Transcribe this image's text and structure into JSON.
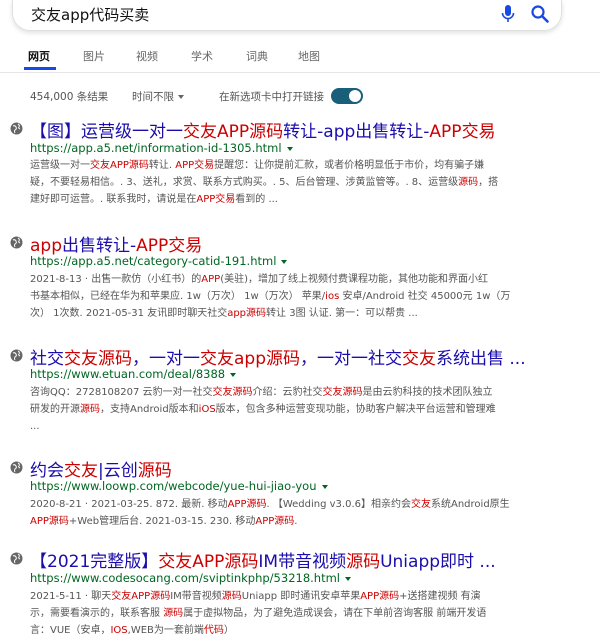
{
  "search": {
    "query": "交友app代码买卖"
  },
  "tabs": [
    "网页",
    "图片",
    "视频",
    "学术",
    "词典",
    "地图"
  ],
  "toolbar": {
    "count": "454,000 条结果",
    "time": "时间不限",
    "new_tab": "在新选项卡中打开链接"
  },
  "colors": {
    "link": "#1a0dab",
    "highlight": "#cc0000",
    "url": "#006621",
    "accent": "#174ae4",
    "toggle": "#1a5f7a"
  },
  "results": [
    {
      "title": [
        [
          "【图】运营级一对一",
          false
        ],
        [
          "交友",
          true
        ],
        [
          "APP",
          true
        ],
        [
          "源码",
          true
        ],
        [
          "转让-app出售转让-",
          false
        ],
        [
          "APP",
          true
        ],
        [
          "交易",
          true
        ]
      ],
      "url": "https://app.a5.net/information-id-1305.html",
      "lines": [
        [
          [
            "运营级一对一",
            false
          ],
          [
            "交友",
            true
          ],
          [
            "APP",
            true
          ],
          [
            "源码",
            true
          ],
          [
            "转让. ",
            false
          ],
          [
            "APP",
            true
          ],
          [
            "交易",
            true
          ],
          [
            "提醒您：让你提前汇款，或者价格明显低于市价，均有骗子嫌",
            false
          ]
        ],
        [
          [
            "疑，不要轻易相信。. 3、送礼，求赏、联系方式购买。. 5、后台管理、涉黄监管等。. 8、运营级",
            false
          ],
          [
            "源码",
            true
          ],
          [
            "，搭",
            false
          ]
        ],
        [
          [
            "建好即可运营。. 联系我时，请说是在",
            false
          ],
          [
            "APP",
            true
          ],
          [
            "交易",
            true
          ],
          [
            "看到的 ...",
            false
          ]
        ]
      ]
    },
    {
      "title": [
        [
          "app",
          true
        ],
        [
          "出售转让-",
          false
        ],
        [
          "APP",
          true
        ],
        [
          "交易",
          true
        ]
      ],
      "url": "https://app.a5.net/category-catid-191.html",
      "lines": [
        [
          [
            "2021-8-13 · 出售一款仿（小红书）的",
            false
          ],
          [
            "APP",
            true
          ],
          [
            "(美驻)，增加了线上视频付费课程功能，其他功能和界面小红",
            false
          ]
        ],
        [
          [
            "书基本相似，已经在华为和苹果应. 1w（万次） 1w（万次） 苹果/",
            false
          ],
          [
            "ios",
            true
          ],
          [
            " 安卓/Android 社交 45000元 1w（万",
            false
          ]
        ],
        [
          [
            "次） 1次数. 2021-05-31 友讯即时聊天社交",
            false
          ],
          [
            "app",
            true
          ],
          [
            "源码",
            true
          ],
          [
            "转让 3图 认证. 第一：可以帮贵 ...",
            false
          ]
        ]
      ]
    },
    {
      "title": [
        [
          "社交",
          false
        ],
        [
          "交友",
          true
        ],
        [
          "源码",
          true
        ],
        [
          "，一对一",
          false
        ],
        [
          "交友",
          true
        ],
        [
          "app",
          true
        ],
        [
          "源码",
          true
        ],
        [
          "，一对一社交",
          false
        ],
        [
          "交友",
          true
        ],
        [
          "系统出售 ...",
          false
        ]
      ],
      "url": "https://www.etuan.com/deal/8388",
      "lines": [
        [
          [
            "咨询QQ：2728108207 云豹一对一社交",
            false
          ],
          [
            "交友",
            true
          ],
          [
            "源码",
            true
          ],
          [
            "介绍：云豹社交",
            false
          ],
          [
            "交友",
            true
          ],
          [
            "源码",
            true
          ],
          [
            "是由云豹科技的技术团队独立",
            false
          ]
        ],
        [
          [
            "研发的开源",
            false
          ],
          [
            "源码",
            true
          ],
          [
            "，支持Android版本和",
            false
          ],
          [
            "iOS",
            true
          ],
          [
            "版本，包含多种运营变现功能，协助客户解决平台运营和管理难",
            false
          ]
        ],
        [
          [
            "...",
            false
          ]
        ]
      ]
    },
    {
      "title": [
        [
          "约会",
          false
        ],
        [
          "交友",
          true
        ],
        [
          "|云创",
          false
        ],
        [
          "源码",
          true
        ]
      ],
      "url": "https://www.loowp.com/webcode/yue-hui-jiao-you",
      "lines": [
        [
          [
            "2020-8-21 · 2021-03-25. 872. 最新. 移动",
            false
          ],
          [
            "APP",
            true
          ],
          [
            "源码",
            true
          ],
          [
            ". 【Wedding v3.0.6】相亲约会",
            false
          ],
          [
            "交友",
            true
          ],
          [
            "系统Android原生",
            false
          ]
        ],
        [
          [
            "APP",
            true
          ],
          [
            "源码",
            true
          ],
          [
            "+Web管理后台. 2021-03-15. 230. 移动",
            false
          ],
          [
            "APP",
            true
          ],
          [
            "源码",
            true
          ],
          [
            ".",
            false
          ]
        ]
      ]
    },
    {
      "title": [
        [
          "【2021完整版】",
          false
        ],
        [
          "交友",
          true
        ],
        [
          "APP",
          true
        ],
        [
          "源码",
          true
        ],
        [
          "IM带音视频",
          false
        ],
        [
          "源码",
          true
        ],
        [
          "Uniapp即时 ...",
          false
        ]
      ],
      "url": "https://www.codesocang.com/sviptinkphp/53218.html",
      "lines": [
        [
          [
            "2021-5-11 · 聊天",
            false
          ],
          [
            "交友",
            true
          ],
          [
            "APP",
            true
          ],
          [
            "源码",
            true
          ],
          [
            "IM带音视频",
            false
          ],
          [
            "源码",
            true
          ],
          [
            "Uniapp 即时通讯安卓苹果",
            false
          ],
          [
            "APP",
            true
          ],
          [
            "源码",
            true
          ],
          [
            "+送搭建视频 有演",
            false
          ]
        ],
        [
          [
            "示，需要看演示的，联系客服 ",
            false
          ],
          [
            "源码",
            true
          ],
          [
            "属于虚拟物品，为了避免造成误会，请在下单前咨询客服 前端开发语",
            false
          ]
        ],
        [
          [
            "言：VUE（安卓，",
            false
          ],
          [
            "IOS",
            true
          ],
          [
            ",WEB为一套前端",
            false
          ],
          [
            "代码",
            true
          ],
          [
            "）",
            false
          ]
        ]
      ]
    }
  ]
}
